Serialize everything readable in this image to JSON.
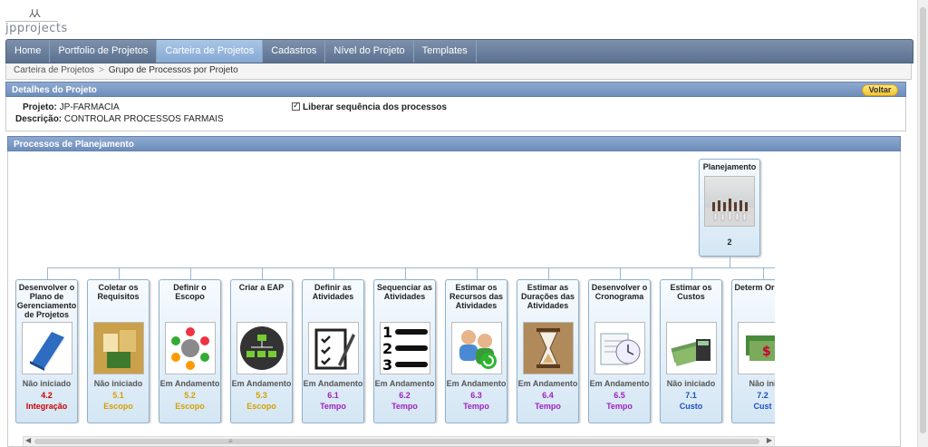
{
  "logo": {
    "text": "jpprojects",
    "figures": "⅄⅄"
  },
  "menu": [
    {
      "label": "Home",
      "active": false
    },
    {
      "label": "Portfolio de Projetos",
      "active": false
    },
    {
      "label": "Carteira de Projetos",
      "active": true
    },
    {
      "label": "Cadastros",
      "active": false
    },
    {
      "label": "Nível do Projeto",
      "active": false
    },
    {
      "label": "Templates",
      "active": false
    }
  ],
  "breadcrumb": {
    "parent": "Carteira de Projetos",
    "separator": ">",
    "current": "Grupo de Processos por Projeto"
  },
  "details": {
    "header": "Detalhes do Projeto",
    "back_label": "Voltar",
    "project_label": "Projeto:",
    "project_value": "JP-FARMACIA",
    "description_label": "Descrição:",
    "description_value": "CONTROLAR PROCESSOS FARMAIS",
    "checkbox_label": "Liberar sequência dos processos",
    "checkbox_checked": true
  },
  "processes": {
    "header": "Processos de Planejamento",
    "root": {
      "title": "Planejamento",
      "number": "2",
      "icon": "chess-icon"
    },
    "items": [
      {
        "title": "Desenvolver o Plano de Gerenciamento de Projetos",
        "status": "Não iniciado",
        "code": "4.2",
        "area": "Integração",
        "color": "#cc0000",
        "icon": "book-icon"
      },
      {
        "title": "Coletar os Requisitos",
        "status": "Não iniciado",
        "code": "5.1",
        "area": "Escopo",
        "color": "#d4a000",
        "icon": "requirements-icon"
      },
      {
        "title": "Definir o Escopo",
        "status": "Em Andamento",
        "code": "5.2",
        "area": "Escopo",
        "color": "#d4a000",
        "icon": "team-circle-icon"
      },
      {
        "title": "Criar a EAP",
        "status": "Em Andamento",
        "code": "5.3",
        "area": "Escopo",
        "color": "#d4a000",
        "icon": "network-icon"
      },
      {
        "title": "Definir as Atividades",
        "status": "Em Andamento",
        "code": "6.1",
        "area": "Tempo",
        "color": "#a020c0",
        "icon": "checklist-icon"
      },
      {
        "title": "Sequenciar as Atividades",
        "status": "Em Andamento",
        "code": "6.2",
        "area": "Tempo",
        "color": "#a020c0",
        "icon": "numbered-list-icon"
      },
      {
        "title": "Estimar os Recursos das Atividades",
        "status": "Em Andamento",
        "code": "6.3",
        "area": "Tempo",
        "color": "#a020c0",
        "icon": "people-icon"
      },
      {
        "title": "Estimar as Durações das Atividades",
        "status": "Em Andamento",
        "code": "6.4",
        "area": "Tempo",
        "color": "#a020c0",
        "icon": "hourglass-icon"
      },
      {
        "title": "Desenvolver o Cronograma",
        "status": "Em Andamento",
        "code": "6.5",
        "area": "Tempo",
        "color": "#a020c0",
        "icon": "clock-calendar-icon"
      },
      {
        "title": "Estimar os Custos",
        "status": "Não iniciado",
        "code": "7.1",
        "area": "Custo",
        "color": "#1a4fc0",
        "icon": "money-calculator-icon"
      },
      {
        "title": "Determ Orçam",
        "status": "Não ini",
        "code": "7.2",
        "area": "Cust",
        "color": "#1a4fc0",
        "icon": "money-icon"
      }
    ]
  }
}
